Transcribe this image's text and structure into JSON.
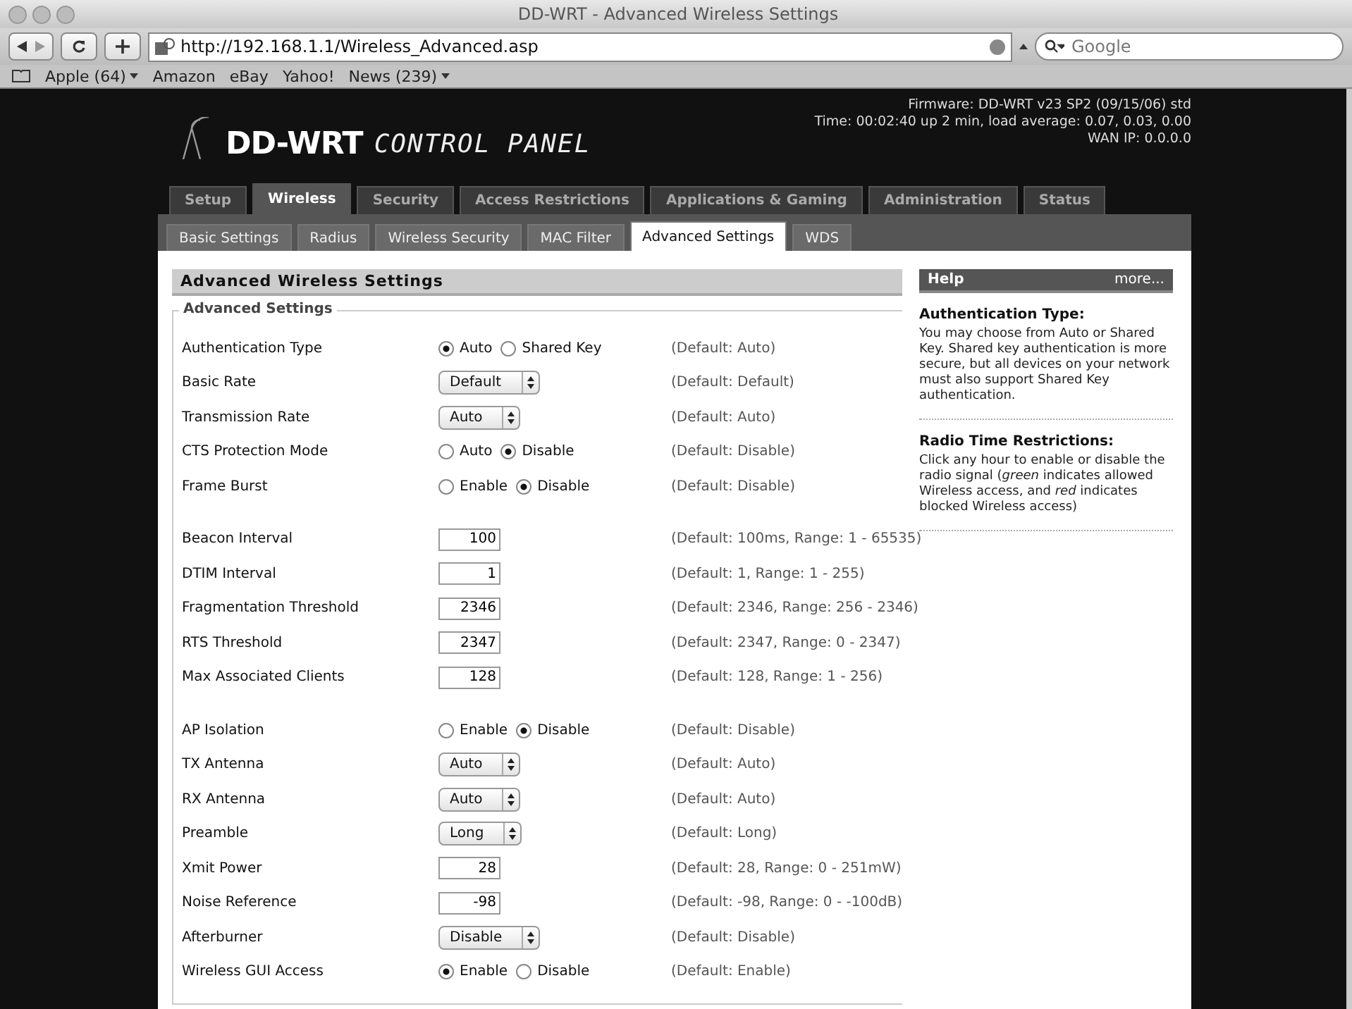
{
  "window": {
    "title": "DD-WRT - Advanced Wireless Settings"
  },
  "toolbar": {
    "url": "http://192.168.1.1/Wireless_Advanced.asp",
    "search": {
      "placeholder": "Google"
    }
  },
  "bookmarks": [
    {
      "label": "Apple (64)",
      "has_menu": true
    },
    {
      "label": "Amazon",
      "has_menu": false
    },
    {
      "label": "eBay",
      "has_menu": false
    },
    {
      "label": "Yahoo!",
      "has_menu": false
    },
    {
      "label": "News (239)",
      "has_menu": true
    }
  ],
  "header": {
    "logo": "DD-WRT",
    "logo_subtitle": "CONTROL PANEL",
    "info": [
      "Firmware: DD-WRT v23 SP2 (09/15/06) std",
      "Time: 00:02:40 up 2 min, load average: 0.07, 0.03, 0.00",
      "WAN IP: 0.0.0.0"
    ]
  },
  "tabs": [
    {
      "label": "Setup",
      "selected": false
    },
    {
      "label": "Wireless",
      "selected": true
    },
    {
      "label": "Security",
      "selected": false
    },
    {
      "label": "Access Restrictions",
      "selected": false
    },
    {
      "label": "Applications & Gaming",
      "selected": false
    },
    {
      "label": "Administration",
      "selected": false
    },
    {
      "label": "Status",
      "selected": false
    }
  ],
  "subtabs": [
    {
      "label": "Basic Settings",
      "selected": false
    },
    {
      "label": "Radius",
      "selected": false
    },
    {
      "label": "Wireless Security",
      "selected": false
    },
    {
      "label": "MAC Filter",
      "selected": false
    },
    {
      "label": "Advanced Settings",
      "selected": true
    },
    {
      "label": "WDS",
      "selected": false
    }
  ],
  "section_title": "Advanced Wireless Settings",
  "fieldset_legend": "Advanced Settings",
  "groups": [
    [
      {
        "label": "Authentication Type",
        "kind": "radio",
        "options": [
          {
            "label": "Auto",
            "selected": true
          },
          {
            "label": "Shared Key",
            "selected": false
          }
        ],
        "default": "(Default: Auto)"
      },
      {
        "label": "Basic Rate",
        "kind": "select",
        "value": "Default",
        "default": "(Default: Default)"
      },
      {
        "label": "Transmission Rate",
        "kind": "select",
        "value": "Auto",
        "default": "(Default: Auto)"
      },
      {
        "label": "CTS Protection Mode",
        "kind": "radio",
        "options": [
          {
            "label": "Auto",
            "selected": false
          },
          {
            "label": "Disable",
            "selected": true
          }
        ],
        "default": "(Default: Disable)"
      },
      {
        "label": "Frame Burst",
        "kind": "radio",
        "options": [
          {
            "label": "Enable",
            "selected": false
          },
          {
            "label": "Disable",
            "selected": true
          }
        ],
        "default": "(Default: Disable)"
      }
    ],
    [
      {
        "label": "Beacon Interval",
        "kind": "text",
        "value": "100",
        "default": "(Default: 100ms, Range: 1 - 65535)"
      },
      {
        "label": "DTIM Interval",
        "kind": "text",
        "value": "1",
        "default": "(Default: 1, Range: 1 - 255)"
      },
      {
        "label": "Fragmentation Threshold",
        "kind": "text",
        "value": "2346",
        "default": "(Default: 2346, Range: 256 - 2346)"
      },
      {
        "label": "RTS Threshold",
        "kind": "text",
        "value": "2347",
        "default": "(Default: 2347, Range: 0 - 2347)"
      },
      {
        "label": "Max Associated Clients",
        "kind": "text",
        "value": "128",
        "default": "(Default: 128, Range: 1 - 256)"
      }
    ],
    [
      {
        "label": "AP Isolation",
        "kind": "radio",
        "options": [
          {
            "label": "Enable",
            "selected": false
          },
          {
            "label": "Disable",
            "selected": true
          }
        ],
        "default": "(Default: Disable)"
      },
      {
        "label": "TX Antenna",
        "kind": "select",
        "value": "Auto",
        "default": "(Default: Auto)"
      },
      {
        "label": "RX Antenna",
        "kind": "select",
        "value": "Auto",
        "default": "(Default: Auto)"
      },
      {
        "label": "Preamble",
        "kind": "select",
        "value": "Long",
        "default": "(Default: Long)"
      },
      {
        "label": "Xmit Power",
        "kind": "text",
        "value": "28",
        "default": "(Default: 28, Range: 0 - 251mW)"
      },
      {
        "label": "Noise Reference",
        "kind": "text",
        "value": "-98",
        "default": "(Default: -98, Range: 0 - -100dB)"
      },
      {
        "label": "Afterburner",
        "kind": "select",
        "value": "Disable",
        "default": "(Default: Disable)"
      },
      {
        "label": "Wireless GUI Access",
        "kind": "radio",
        "options": [
          {
            "label": "Enable",
            "selected": true
          },
          {
            "label": "Disable",
            "selected": false
          }
        ],
        "default": "(Default: Enable)"
      }
    ]
  ],
  "help": {
    "title": "Help",
    "more": "more...",
    "entries": [
      {
        "heading": "Authentication Type:",
        "text": "You may choose from Auto or Shared Key. Shared key authentication is more secure, but all devices on your network must also support Shared Key authentication."
      },
      {
        "heading": "Radio Time Restrictions:",
        "text": "Click any hour to enable or disable the radio signal (*green* indicates allowed Wireless access, and *red* indicates blocked Wireless access)"
      }
    ]
  }
}
